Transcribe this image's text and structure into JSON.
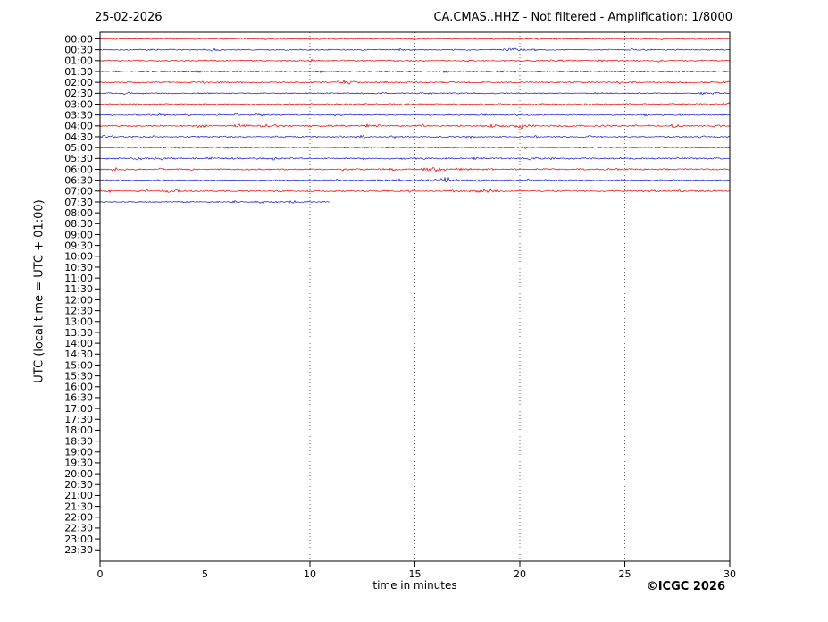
{
  "header": {
    "date": "25-02-2026",
    "title": "CA.CMAS..HHZ - Not filtered - Amplification: 1/8000"
  },
  "footer": {
    "copyright": "©ICGC 2026"
  },
  "chart_data": {
    "type": "line",
    "subtype": "helicorder-seismogram",
    "station": "CA.CMAS..HHZ",
    "filter": "Not filtered",
    "amplification": "1/8000",
    "title": "CA.CMAS..HHZ - Not filtered - Amplification: 1/8000",
    "date": "25-02-2026",
    "xlabel": "time in minutes",
    "ylabel": "UTC (local time = UTC + 01:00)",
    "xlim": [
      0,
      30
    ],
    "x_ticks": [
      0,
      5,
      10,
      15,
      20,
      25,
      30
    ],
    "grid": "vertical-dotted-every-5-min",
    "grid_minutes": [
      5,
      10,
      15,
      20,
      25
    ],
    "legend": "none",
    "colors": {
      "red_trace": "#e60000",
      "blue_trace": "#1515cd",
      "grid": "#555555",
      "frame": "#000000"
    },
    "y_tick_labels": [
      "00:00",
      "00:30",
      "01:00",
      "01:30",
      "02:00",
      "02:30",
      "03:00",
      "03:30",
      "04:00",
      "04:30",
      "05:00",
      "05:30",
      "06:00",
      "06:30",
      "07:00",
      "07:30",
      "08:00",
      "08:30",
      "09:00",
      "09:30",
      "10:00",
      "10:30",
      "11:00",
      "11:30",
      "12:00",
      "12:30",
      "13:00",
      "13:30",
      "14:00",
      "14:30",
      "15:00",
      "15:30",
      "16:00",
      "16:30",
      "17:00",
      "17:30",
      "18:00",
      "18:30",
      "19:00",
      "19:30",
      "20:00",
      "20:30",
      "21:00",
      "21:30",
      "22:00",
      "22:30",
      "23:00",
      "23:30"
    ],
    "traces": [
      {
        "label": "00:00",
        "color": "red",
        "start_min": 0,
        "end_min": 30,
        "noise_amp": 0.8
      },
      {
        "label": "00:30",
        "color": "blue",
        "start_min": 0,
        "end_min": 30,
        "noise_amp": 0.8
      },
      {
        "label": "01:00",
        "color": "red",
        "start_min": 0,
        "end_min": 30,
        "noise_amp": 0.9
      },
      {
        "label": "01:30",
        "color": "blue",
        "start_min": 0,
        "end_min": 30,
        "noise_amp": 0.9
      },
      {
        "label": "02:00",
        "color": "red",
        "start_min": 0,
        "end_min": 30,
        "noise_amp": 1.0
      },
      {
        "label": "02:30",
        "color": "blue",
        "start_min": 0,
        "end_min": 30,
        "noise_amp": 0.8
      },
      {
        "label": "03:00",
        "color": "red",
        "start_min": 0,
        "end_min": 30,
        "noise_amp": 0.9
      },
      {
        "label": "03:30",
        "color": "blue",
        "start_min": 0,
        "end_min": 30,
        "noise_amp": 0.8
      },
      {
        "label": "04:00",
        "color": "red",
        "start_min": 0,
        "end_min": 30,
        "noise_amp": 1.1
      },
      {
        "label": "04:30",
        "color": "blue",
        "start_min": 0,
        "end_min": 30,
        "noise_amp": 0.9
      },
      {
        "label": "05:00",
        "color": "red",
        "start_min": 0,
        "end_min": 30,
        "noise_amp": 0.8
      },
      {
        "label": "05:30",
        "color": "blue",
        "start_min": 0,
        "end_min": 30,
        "noise_amp": 1.1
      },
      {
        "label": "06:00",
        "color": "red",
        "start_min": 0,
        "end_min": 30,
        "noise_amp": 1.0
      },
      {
        "label": "06:30",
        "color": "blue",
        "start_min": 0,
        "end_min": 30,
        "noise_amp": 0.9
      },
      {
        "label": "07:00",
        "color": "red",
        "start_min": 0,
        "end_min": 30,
        "noise_amp": 1.0
      },
      {
        "label": "07:30",
        "color": "blue",
        "start_min": 0,
        "end_min": 11.0,
        "noise_amp": 0.9
      }
    ],
    "no_data_after": "07:30 (trace stops at ~11 min); rows 08:00-23:30 empty",
    "events": [
      {
        "trace": "00:30",
        "minute": 19.7,
        "amplitude": 1.6
      },
      {
        "trace": "02:00",
        "minute": 11.8,
        "amplitude": 1.6
      },
      {
        "trace": "04:00",
        "minute": 20.0,
        "amplitude": 1.4
      },
      {
        "trace": "06:00",
        "minute": 15.8,
        "amplitude": 2.4
      },
      {
        "trace": "06:30",
        "minute": 16.4,
        "amplitude": 2.6
      },
      {
        "trace": "07:00",
        "minute": 18.3,
        "amplitude": 1.5
      }
    ]
  }
}
